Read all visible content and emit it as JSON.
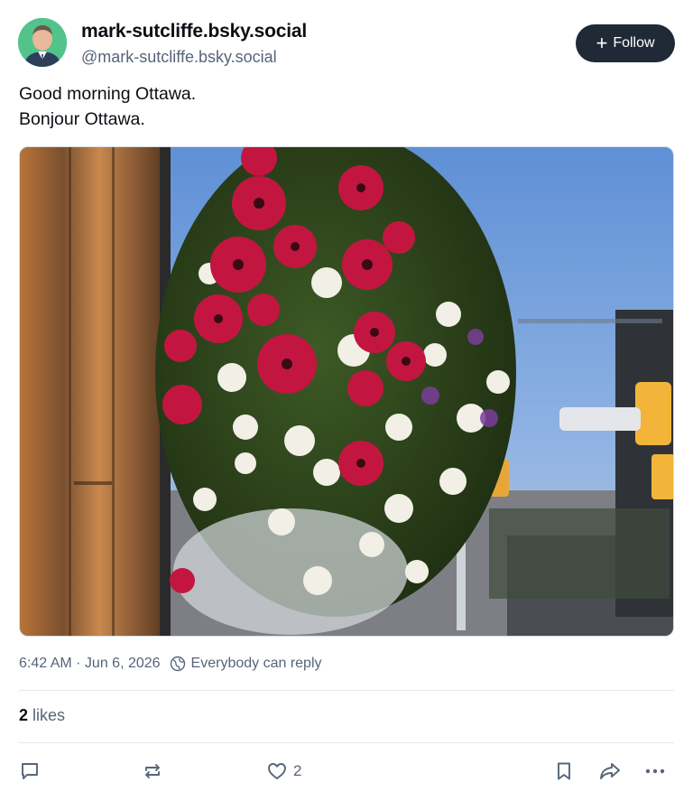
{
  "author": {
    "display_name": "mark-sutcliffe.bsky.social",
    "handle": "@mark-sutcliffe.bsky.social",
    "avatar_bg": "#52c38a"
  },
  "follow_button": {
    "label": "Follow",
    "icon": "plus-icon"
  },
  "post": {
    "lines": [
      "Good morning Ottawa.",
      "Bonjour Ottawa."
    ],
    "image_description_icon": "photo"
  },
  "meta": {
    "timestamp": "6:42 AM · Jun 6, 2026",
    "reply_setting": "Everybody can reply",
    "reply_icon": "globe-icon"
  },
  "stats": {
    "likes_count": "2",
    "likes_label": "likes"
  },
  "actions": {
    "reply_icon": "comment-icon",
    "repost_icon": "repost-icon",
    "like_icon": "heart-icon",
    "like_count": "2",
    "bookmark_icon": "bookmark-icon",
    "share_icon": "share-icon",
    "more_icon": "more-icon"
  },
  "colors": {
    "follow_bg": "#1f2a36",
    "muted_text": "#56657a",
    "divider": "#e3e7ec"
  }
}
